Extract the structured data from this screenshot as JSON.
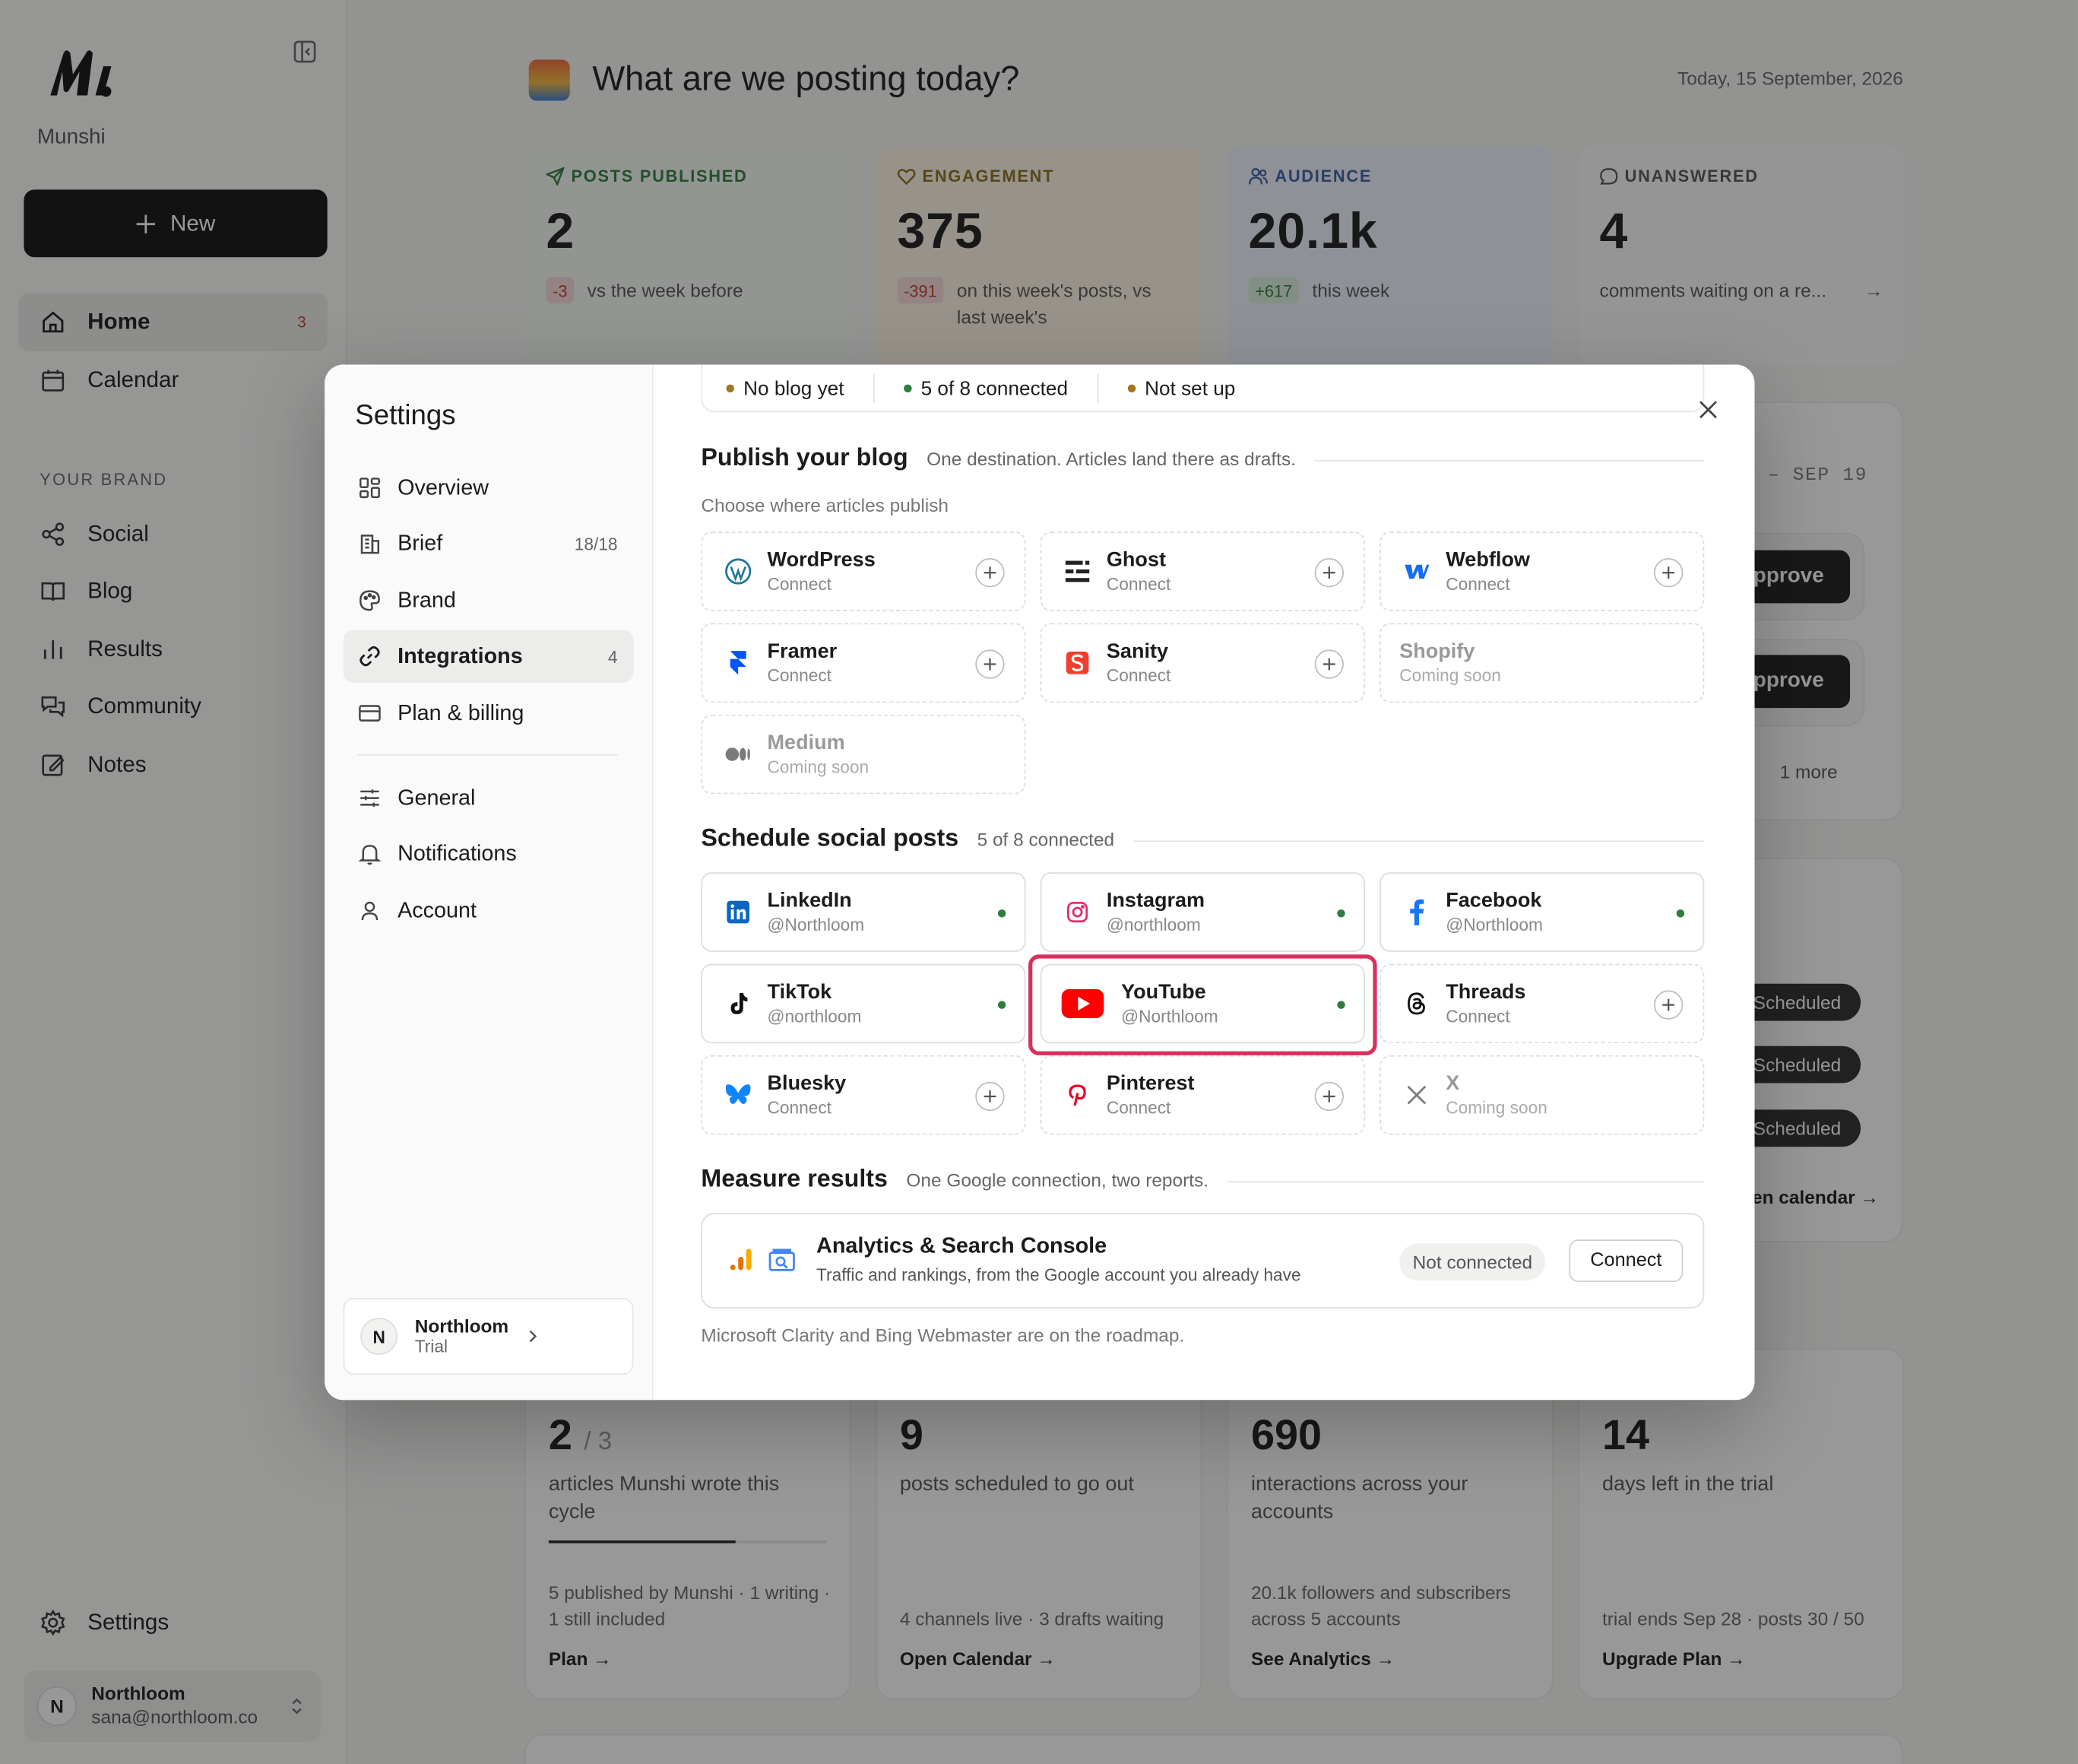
{
  "app": {
    "name": "Munshi",
    "new_label": "New",
    "nav": [
      {
        "label": "Home",
        "badge": "3"
      },
      {
        "label": "Calendar"
      }
    ],
    "brand_section_label": "YOUR BRAND",
    "brand_nav": [
      {
        "label": "Social"
      },
      {
        "label": "Blog"
      },
      {
        "label": "Results"
      },
      {
        "label": "Community"
      },
      {
        "label": "Notes"
      }
    ],
    "settings_label": "Settings",
    "user": {
      "initial": "N",
      "name": "Northloom",
      "email": "sana@northloom.co"
    }
  },
  "header": {
    "title": "What are we posting today?",
    "date": "Today, 15 September, 2026"
  },
  "stats": [
    {
      "label": "POSTS PUBLISHED",
      "value": "2",
      "delta": "-3",
      "note": "vs the week before",
      "color": "#2e7d3f"
    },
    {
      "label": "ENGAGEMENT",
      "value": "375",
      "delta": "-391",
      "note": "on this week's posts, vs last week's",
      "color": "#8a6d1e"
    },
    {
      "label": "AUDIENCE",
      "value": "20.1k",
      "delta": "+617",
      "note": "this week",
      "color": "#3b5ea8"
    },
    {
      "label": "UNANSWERED",
      "value": "4",
      "note": "comments waiting on a re..."
    }
  ],
  "background_panel": {
    "range_label": "– SEP 19",
    "approve_label": "pprove",
    "more_label": "1 more",
    "scheduled_label": "Scheduled",
    "calendar_link": "en calendar →"
  },
  "bottom_stats": [
    {
      "value": "2",
      "suffix": "/ 3",
      "desc": "articles Munshi wrote this cycle",
      "progress": 0.67,
      "foot": "5 published by Munshi · 1 writing · 1 still included",
      "link": "Plan →"
    },
    {
      "value": "9",
      "desc": "posts scheduled to go out",
      "foot": "4 channels live · 3 drafts waiting",
      "link": "Open Calendar →"
    },
    {
      "value": "690",
      "desc": "interactions across your accounts",
      "foot": "20.1k followers and subscribers across 5 accounts",
      "link": "See Analytics →"
    },
    {
      "value": "14",
      "desc": "days left in the trial",
      "foot": "trial ends Sep 28 · posts 30 / 50",
      "link": "Upgrade Plan →"
    }
  ],
  "settings": {
    "title": "Settings",
    "menu": [
      {
        "label": "Overview"
      },
      {
        "label": "Brief",
        "count": "18/18"
      },
      {
        "label": "Brand"
      },
      {
        "label": "Integrations",
        "count": "4",
        "active": true
      },
      {
        "label": "Plan & billing"
      }
    ],
    "menu2": [
      {
        "label": "General"
      },
      {
        "label": "Notifications"
      },
      {
        "label": "Account"
      }
    ],
    "workspace": {
      "initial": "N",
      "name": "Northloom",
      "plan": "Trial"
    },
    "status": [
      {
        "label": "No blog yet",
        "color": "#a0761e"
      },
      {
        "label": "5 of 8 connected",
        "color": "#2e7d3f"
      },
      {
        "label": "Not set up",
        "color": "#a0761e"
      }
    ],
    "blog": {
      "title": "Publish your blog",
      "subtitle": "One destination. Articles land there as drafts.",
      "caption": "Choose where articles publish",
      "tiles": [
        {
          "name": "WordPress",
          "status": "Connect",
          "icon": "wordpress-icon"
        },
        {
          "name": "Ghost",
          "status": "Connect",
          "icon": "ghost-icon"
        },
        {
          "name": "Webflow",
          "status": "Connect",
          "icon": "webflow-icon"
        },
        {
          "name": "Framer",
          "status": "Connect",
          "icon": "framer-icon"
        },
        {
          "name": "Sanity",
          "status": "Connect",
          "icon": "sanity-icon"
        },
        {
          "name": "Shopify",
          "status": "Coming soon",
          "icon": "shopify-icon"
        },
        {
          "name": "Medium",
          "status": "Coming soon",
          "icon": "medium-icon"
        }
      ]
    },
    "social": {
      "title": "Schedule social posts",
      "subtitle": "5 of 8 connected",
      "tiles": [
        {
          "name": "LinkedIn",
          "status": "@Northloom",
          "icon": "linkedin-icon",
          "connected": true
        },
        {
          "name": "Instagram",
          "status": "@northloom",
          "icon": "instagram-icon",
          "connected": true
        },
        {
          "name": "Facebook",
          "status": "@Northloom",
          "icon": "facebook-icon",
          "connected": true
        },
        {
          "name": "TikTok",
          "status": "@northloom",
          "icon": "tiktok-icon",
          "connected": true
        },
        {
          "name": "YouTube",
          "status": "@Northloom",
          "icon": "youtube-icon",
          "connected": true
        },
        {
          "name": "Threads",
          "status": "Connect",
          "icon": "threads-icon"
        },
        {
          "name": "Bluesky",
          "status": "Connect",
          "icon": "bluesky-icon"
        },
        {
          "name": "Pinterest",
          "status": "Connect",
          "icon": "pinterest-icon"
        },
        {
          "name": "X",
          "status": "Coming soon",
          "icon": "x-icon"
        }
      ]
    },
    "measure": {
      "title": "Measure results",
      "subtitle": "One Google connection, two reports.",
      "card_title": "Analytics & Search Console",
      "card_desc": "Traffic and rankings, from the Google account you already have",
      "status": "Not connected",
      "button": "Connect",
      "footnote": "Microsoft Clarity and Bing Webmaster are on the roadmap."
    }
  }
}
